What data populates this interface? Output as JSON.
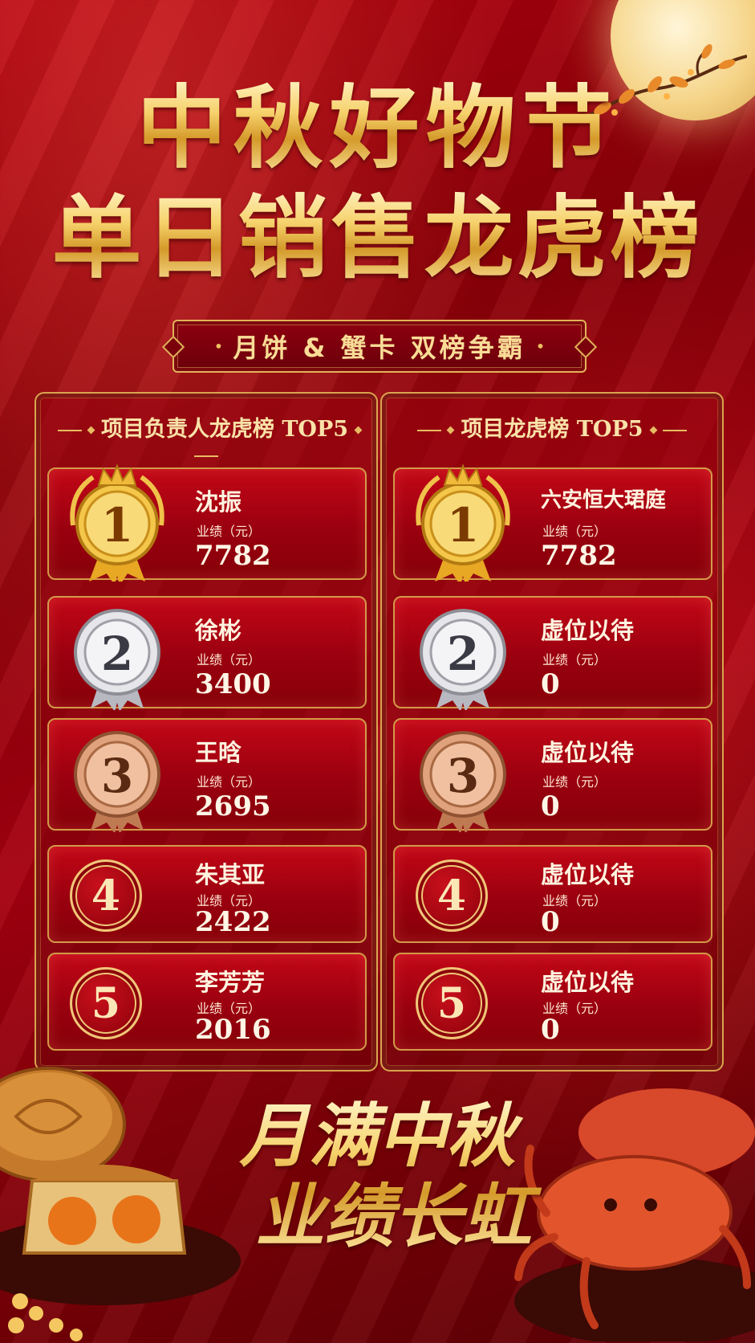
{
  "header": {
    "title_line1": "中秋好物节",
    "title_line2": "单日销售龙虎榜",
    "subtitle": "月饼 & 蟹卡 双榜争霸",
    "subtitle_dot": "•"
  },
  "left_board": {
    "title": "项目负责人龙虎榜 TOP5",
    "entries": [
      {
        "rank": "1",
        "name": "沈振",
        "unit": "业绩（元）",
        "value": "7782"
      },
      {
        "rank": "2",
        "name": "徐彬",
        "unit": "业绩（元）",
        "value": "3400"
      },
      {
        "rank": "3",
        "name": "王晗",
        "unit": "业绩（元）",
        "value": "2695"
      },
      {
        "rank": "4",
        "name": "朱其亚",
        "unit": "业绩（元）",
        "value": "2422"
      },
      {
        "rank": "5",
        "name": "李芳芳",
        "unit": "业绩（元）",
        "value": "2016"
      }
    ]
  },
  "right_board": {
    "title": "项目龙虎榜 TOP5",
    "entries": [
      {
        "rank": "1",
        "name": "六安恒大珺庭",
        "unit": "业绩（元）",
        "value": "7782"
      },
      {
        "rank": "2",
        "name": "虚位以待",
        "unit": "业绩（元）",
        "value": "0"
      },
      {
        "rank": "3",
        "name": "虚位以待",
        "unit": "业绩（元）",
        "value": "0"
      },
      {
        "rank": "4",
        "name": "虚位以待",
        "unit": "业绩（元）",
        "value": "0"
      },
      {
        "rank": "5",
        "name": "虚位以待",
        "unit": "业绩（元）",
        "value": "0"
      }
    ]
  },
  "footer": {
    "slogan_line1": "月满中秋",
    "slogan_line2": "业绩长虹"
  },
  "colors": {
    "background_red": "#a50010",
    "gold": "#e2b35a",
    "medal_gold": "#f4c64a",
    "medal_silver": "#d9d9de",
    "medal_bronze": "#d79a72"
  },
  "icons": {
    "rank1": "gold-medal-icon",
    "rank2": "silver-medal-icon",
    "rank3": "bronze-medal-icon",
    "rank4": "rank-badge-icon",
    "rank5": "rank-badge-icon"
  }
}
